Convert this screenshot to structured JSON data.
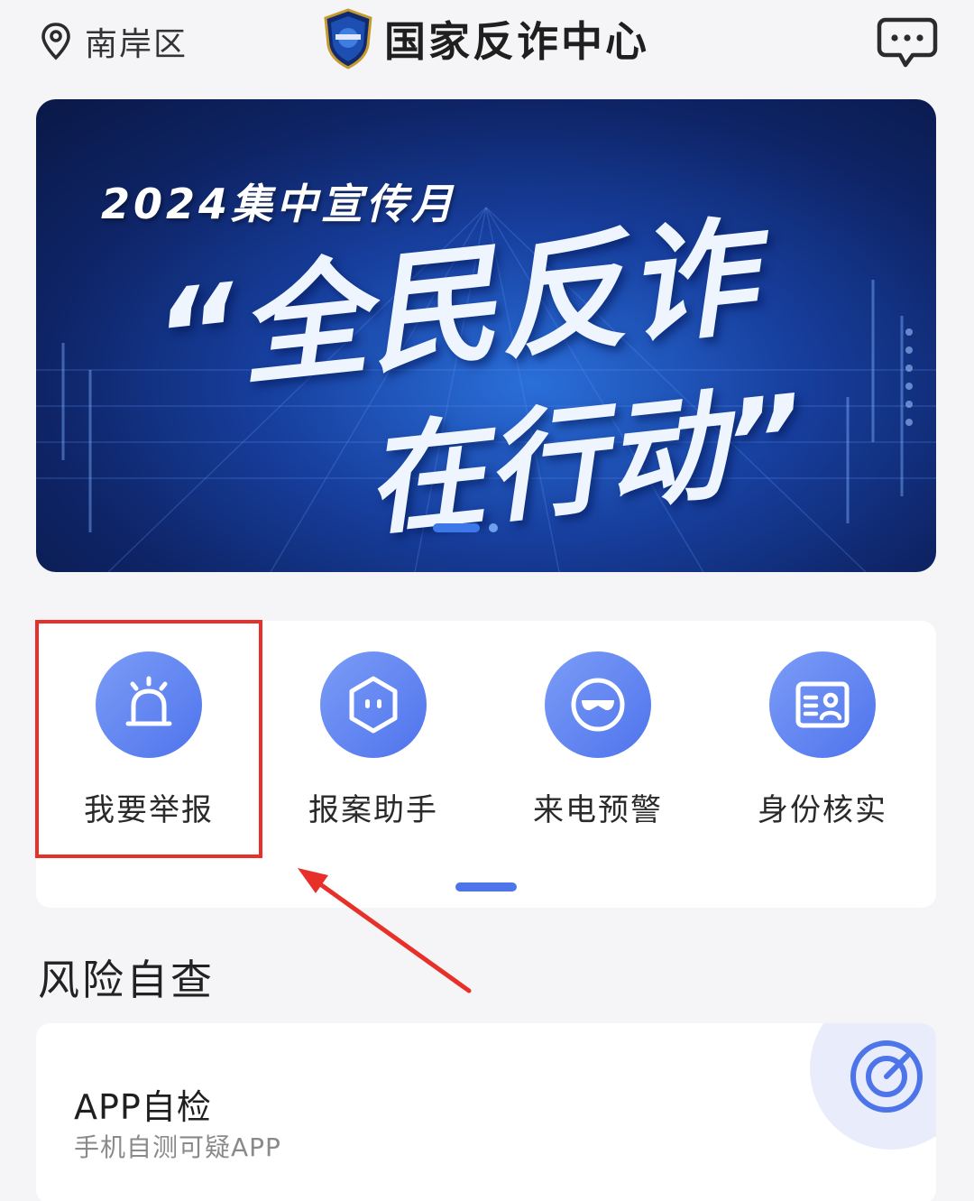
{
  "header": {
    "location": "南岸区",
    "title": "国家反诈中心",
    "location_icon": "map-pin-icon",
    "message_icon": "chat-bubble-icon"
  },
  "banner": {
    "subtitle": "2024集中宣传月",
    "headline_line1": "“全民反诈",
    "headline_line2": "在行动”",
    "slide_index": 1,
    "slide_count": 2
  },
  "services": {
    "items": [
      {
        "label": "我要举报",
        "icon": "alarm-light-icon",
        "highlighted": true
      },
      {
        "label": "报案助手",
        "icon": "robot-hexagon-icon",
        "highlighted": false
      },
      {
        "label": "来电预警",
        "icon": "mask-icon",
        "highlighted": false
      },
      {
        "label": "身份核实",
        "icon": "id-card-icon",
        "highlighted": false
      }
    ]
  },
  "risk": {
    "section_title": "风险自查",
    "card": {
      "title": "APP自检",
      "subtitle": "手机自测可疑APP",
      "icon": "target-icon"
    }
  },
  "colors": {
    "accent": "#4e74ea",
    "annotation": "#e8302b",
    "background": "#f5f5f7"
  }
}
